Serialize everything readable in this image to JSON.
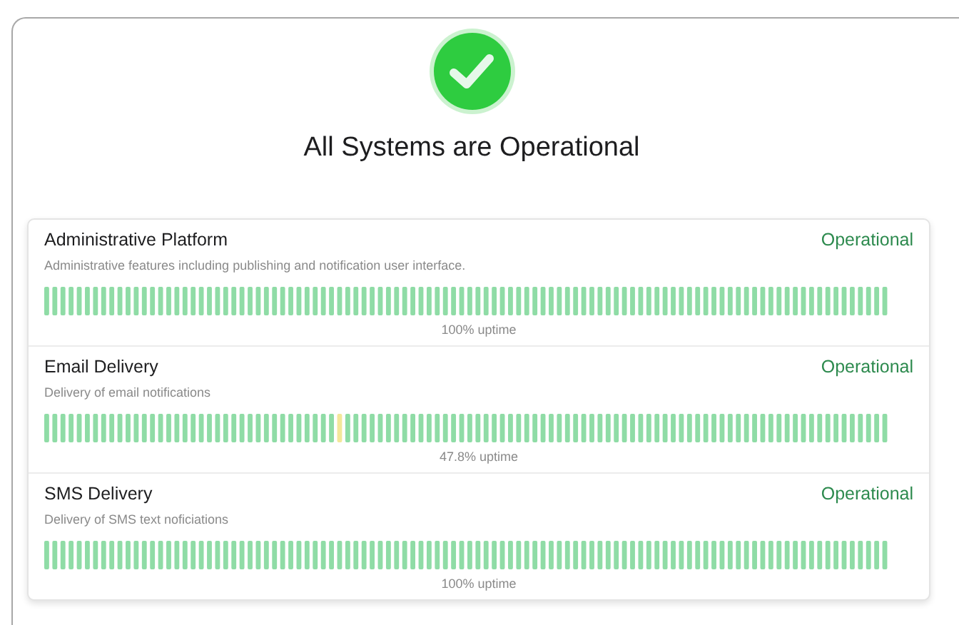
{
  "status_banner": {
    "all_operational": true,
    "title": "All Systems are Operational"
  },
  "components": [
    {
      "name": "Administrative Platform",
      "status": "Operational",
      "description": "Administrative features including publishing and notification user interface.",
      "uptime": "100% uptime",
      "bars": [
        {
          "incident": false
        },
        {
          "incident": false
        },
        {
          "incident": false
        },
        {
          "incident": false
        },
        {
          "incident": false
        },
        {
          "incident": false
        },
        {
          "incident": false
        },
        {
          "incident": false
        },
        {
          "incident": false
        },
        {
          "incident": false
        },
        {
          "incident": false
        },
        {
          "incident": false
        },
        {
          "incident": false
        },
        {
          "incident": false
        },
        {
          "incident": false
        },
        {
          "incident": false
        },
        {
          "incident": false
        },
        {
          "incident": false
        },
        {
          "incident": false
        },
        {
          "incident": false
        },
        {
          "incident": false
        },
        {
          "incident": false
        },
        {
          "incident": false
        },
        {
          "incident": false
        },
        {
          "incident": false
        },
        {
          "incident": false
        },
        {
          "incident": false
        },
        {
          "incident": false
        },
        {
          "incident": false
        },
        {
          "incident": false
        },
        {
          "incident": false
        },
        {
          "incident": false
        },
        {
          "incident": false
        },
        {
          "incident": false
        },
        {
          "incident": false
        },
        {
          "incident": false
        },
        {
          "incident": false
        },
        {
          "incident": false
        },
        {
          "incident": false
        },
        {
          "incident": false
        },
        {
          "incident": false
        },
        {
          "incident": false
        },
        {
          "incident": false
        },
        {
          "incident": false
        },
        {
          "incident": false
        },
        {
          "incident": false
        },
        {
          "incident": false
        },
        {
          "incident": false
        },
        {
          "incident": false
        },
        {
          "incident": false
        },
        {
          "incident": false
        },
        {
          "incident": false
        },
        {
          "incident": false
        },
        {
          "incident": false
        },
        {
          "incident": false
        },
        {
          "incident": false
        },
        {
          "incident": false
        },
        {
          "incident": false
        },
        {
          "incident": false
        },
        {
          "incident": false
        },
        {
          "incident": false
        },
        {
          "incident": false
        },
        {
          "incident": false
        },
        {
          "incident": false
        },
        {
          "incident": false
        },
        {
          "incident": false
        },
        {
          "incident": false
        },
        {
          "incident": false
        },
        {
          "incident": false
        },
        {
          "incident": false
        },
        {
          "incident": false
        },
        {
          "incident": false
        },
        {
          "incident": false
        },
        {
          "incident": false
        },
        {
          "incident": false
        },
        {
          "incident": false
        },
        {
          "incident": false
        },
        {
          "incident": false
        },
        {
          "incident": false
        },
        {
          "incident": false
        },
        {
          "incident": false
        },
        {
          "incident": false
        },
        {
          "incident": false
        },
        {
          "incident": false
        },
        {
          "incident": false
        },
        {
          "incident": false
        },
        {
          "incident": false
        },
        {
          "incident": false
        },
        {
          "incident": false
        },
        {
          "incident": false
        },
        {
          "incident": false
        },
        {
          "incident": false
        },
        {
          "incident": false
        },
        {
          "incident": false
        },
        {
          "incident": false
        },
        {
          "incident": false
        },
        {
          "incident": false
        },
        {
          "incident": false
        },
        {
          "incident": false
        },
        {
          "incident": false
        },
        {
          "incident": false
        },
        {
          "incident": false
        },
        {
          "incident": false
        },
        {
          "incident": false
        }
      ]
    },
    {
      "name": "Email Delivery",
      "status": "Operational",
      "description": "Delivery of email notifications",
      "uptime": "47.8% uptime",
      "bars": [
        {
          "incident": false
        },
        {
          "incident": false
        },
        {
          "incident": false
        },
        {
          "incident": false
        },
        {
          "incident": false
        },
        {
          "incident": false
        },
        {
          "incident": false
        },
        {
          "incident": false
        },
        {
          "incident": false
        },
        {
          "incident": false
        },
        {
          "incident": false
        },
        {
          "incident": false
        },
        {
          "incident": false
        },
        {
          "incident": false
        },
        {
          "incident": false
        },
        {
          "incident": false
        },
        {
          "incident": false
        },
        {
          "incident": false
        },
        {
          "incident": false
        },
        {
          "incident": false
        },
        {
          "incident": false
        },
        {
          "incident": false
        },
        {
          "incident": false
        },
        {
          "incident": false
        },
        {
          "incident": false
        },
        {
          "incident": false
        },
        {
          "incident": false
        },
        {
          "incident": false
        },
        {
          "incident": false
        },
        {
          "incident": false
        },
        {
          "incident": false
        },
        {
          "incident": false
        },
        {
          "incident": false
        },
        {
          "incident": false
        },
        {
          "incident": false
        },
        {
          "incident": false
        },
        {
          "incident": true
        },
        {
          "incident": false
        },
        {
          "incident": false
        },
        {
          "incident": false
        },
        {
          "incident": false
        },
        {
          "incident": false
        },
        {
          "incident": false
        },
        {
          "incident": false
        },
        {
          "incident": false
        },
        {
          "incident": false
        },
        {
          "incident": false
        },
        {
          "incident": false
        },
        {
          "incident": false
        },
        {
          "incident": false
        },
        {
          "incident": false
        },
        {
          "incident": false
        },
        {
          "incident": false
        },
        {
          "incident": false
        },
        {
          "incident": false
        },
        {
          "incident": false
        },
        {
          "incident": false
        },
        {
          "incident": false
        },
        {
          "incident": false
        },
        {
          "incident": false
        },
        {
          "incident": false
        },
        {
          "incident": false
        },
        {
          "incident": false
        },
        {
          "incident": false
        },
        {
          "incident": false
        },
        {
          "incident": false
        },
        {
          "incident": false
        },
        {
          "incident": false
        },
        {
          "incident": false
        },
        {
          "incident": false
        },
        {
          "incident": false
        },
        {
          "incident": false
        },
        {
          "incident": false
        },
        {
          "incident": false
        },
        {
          "incident": false
        },
        {
          "incident": false
        },
        {
          "incident": false
        },
        {
          "incident": false
        },
        {
          "incident": false
        },
        {
          "incident": false
        },
        {
          "incident": false
        },
        {
          "incident": false
        },
        {
          "incident": false
        },
        {
          "incident": false
        },
        {
          "incident": false
        },
        {
          "incident": false
        },
        {
          "incident": false
        },
        {
          "incident": false
        },
        {
          "incident": false
        },
        {
          "incident": false
        },
        {
          "incident": false
        },
        {
          "incident": false
        },
        {
          "incident": false
        },
        {
          "incident": false
        },
        {
          "incident": false
        },
        {
          "incident": false
        },
        {
          "incident": false
        },
        {
          "incident": false
        },
        {
          "incident": false
        },
        {
          "incident": false
        },
        {
          "incident": false
        },
        {
          "incident": false
        },
        {
          "incident": false
        },
        {
          "incident": false
        }
      ]
    },
    {
      "name": "SMS Delivery",
      "status": "Operational",
      "description": "Delivery of SMS text noficiations",
      "uptime": "100% uptime",
      "bars": [
        {
          "incident": false
        },
        {
          "incident": false
        },
        {
          "incident": false
        },
        {
          "incident": false
        },
        {
          "incident": false
        },
        {
          "incident": false
        },
        {
          "incident": false
        },
        {
          "incident": false
        },
        {
          "incident": false
        },
        {
          "incident": false
        },
        {
          "incident": false
        },
        {
          "incident": false
        },
        {
          "incident": false
        },
        {
          "incident": false
        },
        {
          "incident": false
        },
        {
          "incident": false
        },
        {
          "incident": false
        },
        {
          "incident": false
        },
        {
          "incident": false
        },
        {
          "incident": false
        },
        {
          "incident": false
        },
        {
          "incident": false
        },
        {
          "incident": false
        },
        {
          "incident": false
        },
        {
          "incident": false
        },
        {
          "incident": false
        },
        {
          "incident": false
        },
        {
          "incident": false
        },
        {
          "incident": false
        },
        {
          "incident": false
        },
        {
          "incident": false
        },
        {
          "incident": false
        },
        {
          "incident": false
        },
        {
          "incident": false
        },
        {
          "incident": false
        },
        {
          "incident": false
        },
        {
          "incident": false
        },
        {
          "incident": false
        },
        {
          "incident": false
        },
        {
          "incident": false
        },
        {
          "incident": false
        },
        {
          "incident": false
        },
        {
          "incident": false
        },
        {
          "incident": false
        },
        {
          "incident": false
        },
        {
          "incident": false
        },
        {
          "incident": false
        },
        {
          "incident": false
        },
        {
          "incident": false
        },
        {
          "incident": false
        },
        {
          "incident": false
        },
        {
          "incident": false
        },
        {
          "incident": false
        },
        {
          "incident": false
        },
        {
          "incident": false
        },
        {
          "incident": false
        },
        {
          "incident": false
        },
        {
          "incident": false
        },
        {
          "incident": false
        },
        {
          "incident": false
        },
        {
          "incident": false
        },
        {
          "incident": false
        },
        {
          "incident": false
        },
        {
          "incident": false
        },
        {
          "incident": false
        },
        {
          "incident": false
        },
        {
          "incident": false
        },
        {
          "incident": false
        },
        {
          "incident": false
        },
        {
          "incident": false
        },
        {
          "incident": false
        },
        {
          "incident": false
        },
        {
          "incident": false
        },
        {
          "incident": false
        },
        {
          "incident": false
        },
        {
          "incident": false
        },
        {
          "incident": false
        },
        {
          "incident": false
        },
        {
          "incident": false
        },
        {
          "incident": false
        },
        {
          "incident": false
        },
        {
          "incident": false
        },
        {
          "incident": false
        },
        {
          "incident": false
        },
        {
          "incident": false
        },
        {
          "incident": false
        },
        {
          "incident": false
        },
        {
          "incident": false
        },
        {
          "incident": false
        },
        {
          "incident": false
        },
        {
          "incident": false
        },
        {
          "incident": false
        },
        {
          "incident": false
        },
        {
          "incident": false
        },
        {
          "incident": false
        },
        {
          "incident": false
        },
        {
          "incident": false
        },
        {
          "incident": false
        },
        {
          "incident": false
        },
        {
          "incident": false
        },
        {
          "incident": false
        },
        {
          "incident": false
        },
        {
          "incident": false
        },
        {
          "incident": false
        }
      ]
    }
  ]
}
